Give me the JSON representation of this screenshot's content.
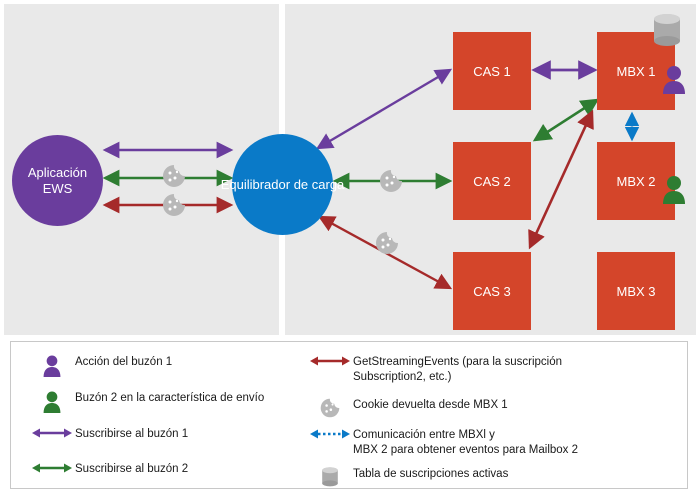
{
  "diagram": {
    "nodes": {
      "ews": {
        "label": "Aplicación EWS",
        "color": "#6a3d9d"
      },
      "load_balancer": {
        "label": "Equilibrador de carga",
        "color": "#0a7ac8"
      },
      "cas": [
        {
          "label": "CAS 1",
          "color": "#d4452a"
        },
        {
          "label": "CAS 2",
          "color": "#d4452a"
        },
        {
          "label": "CAS 3",
          "color": "#d4452a"
        }
      ],
      "mbx": [
        {
          "label": "MBX 1",
          "color": "#d4452a"
        },
        {
          "label": "MBX 2",
          "color": "#d4452a"
        },
        {
          "label": "MBX 3",
          "color": "#d4452a"
        }
      ]
    },
    "icons": {
      "db_mbx1": "database-cylinder-icon",
      "person_mbx1": "person-purple-icon",
      "person_mbx2": "person-green-icon",
      "cookie": "cookie-icon"
    },
    "colors": {
      "purple": "#6a3d9d",
      "green": "#2e7d32",
      "dark_red": "#a52a2a",
      "blue": "#0a7ac8",
      "box_red": "#d4452a",
      "panel_bg": "#e9e9e9",
      "cookie_gray": "#b8b8b8",
      "db_gray": "#aaaaaa"
    }
  },
  "legend": {
    "left": [
      {
        "glyph": "person-purple-icon",
        "text": "Acción del buzón 1"
      },
      {
        "glyph": "person-green-icon",
        "text": "Buzón 2 en la característica de envío"
      },
      {
        "glyph": "arrow-purple-double-icon",
        "text": "Suscribirse al buzón 1"
      },
      {
        "glyph": "arrow-green-double-icon",
        "text": "Suscribirse al buzón 2"
      }
    ],
    "right": [
      {
        "glyph": "arrow-darkred-double-icon",
        "text_line1": "GetStreamingEvents (para la suscripción",
        "text_line2": "Subscription2, etc.)"
      },
      {
        "glyph": "cookie-icon",
        "text_line1": "Cookie devuelta desde MBX 1",
        "text_line2": ""
      },
      {
        "glyph": "arrow-blue-dotted-double-icon",
        "text_line1": "Comunicación entre MBXl y",
        "text_line2": "MBX 2 para obtener eventos para Mailbox 2"
      },
      {
        "glyph": "database-cylinder-icon",
        "text_line1": "Tabla de suscripciones activas",
        "text_line2": ""
      }
    ]
  }
}
